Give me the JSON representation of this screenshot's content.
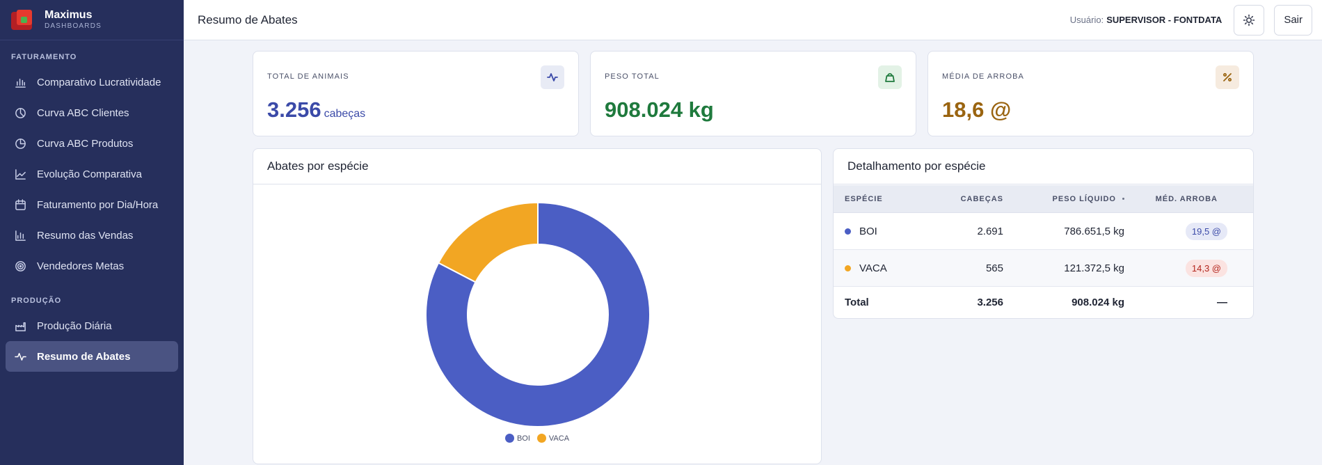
{
  "brand": {
    "name": "Maximus",
    "subtitle": "DASHBOARDS"
  },
  "sidebar": {
    "sections": [
      {
        "title": "FATURAMENTO",
        "items": [
          {
            "label": "Comparativo Lucratividade",
            "icon": "bar-chart-icon"
          },
          {
            "label": "Curva ABC Clientes",
            "icon": "pie-chart-icon"
          },
          {
            "label": "Curva ABC Produtos",
            "icon": "pie-chart-icon"
          },
          {
            "label": "Evolução Comparativa",
            "icon": "line-chart-icon"
          },
          {
            "label": "Faturamento por Dia/Hora",
            "icon": "calendar-icon"
          },
          {
            "label": "Resumo das Vendas",
            "icon": "bar-chart-icon"
          },
          {
            "label": "Vendedores Metas",
            "icon": "target-icon"
          }
        ]
      },
      {
        "title": "PRODUÇÃO",
        "items": [
          {
            "label": "Produção Diária",
            "icon": "factory-icon"
          },
          {
            "label": "Resumo de Abates",
            "icon": "activity-icon",
            "active": true
          }
        ]
      }
    ]
  },
  "header": {
    "title": "Resumo de Abates",
    "user_label": "Usuário:",
    "user_name": "SUPERVISOR - FONTDATA",
    "theme_icon": "sun-icon",
    "logout_label": "Sair"
  },
  "kpis": [
    {
      "label": "TOTAL DE ANIMAIS",
      "value": "3.256",
      "unit": "cabeças",
      "color": "#3b4aa8",
      "icon": "activity-icon",
      "icon_bg": "#e8ebf5",
      "icon_color": "#3b4aa8"
    },
    {
      "label": "PESO TOTAL",
      "value": "908.024 kg",
      "unit": "",
      "color": "#1f7a3d",
      "icon": "weight-icon",
      "icon_bg": "#e3f2e6",
      "icon_color": "#1f7a3d"
    },
    {
      "label": "MÉDIA DE ARROBA",
      "value": "18,6 @",
      "unit": "",
      "color": "#9a6410",
      "icon": "percent-icon",
      "icon_bg": "#f6ebdf",
      "icon_color": "#9a6410"
    }
  ],
  "chart_panel": {
    "title": "Abates por espécie"
  },
  "chart_data": {
    "type": "pie",
    "donut": true,
    "categories": [
      "BOI",
      "VACA"
    ],
    "values": [
      2691,
      565
    ],
    "colors": [
      "#4b5ec4",
      "#f2a623"
    ],
    "legend_position": "bottom"
  },
  "detail_panel": {
    "title": "Detalhamento por espécie",
    "columns": [
      "ESPÉCIE",
      "CABEÇAS",
      "PESO LÍQUIDO",
      "MÉD. ARROBA"
    ],
    "rows": [
      {
        "species": "BOI",
        "heads": "2.691",
        "weight": "786.651,5 kg",
        "avg": "19,5 @",
        "dot_color": "#4b5ec4",
        "badge_bg": "#e6e9f7",
        "badge_color": "#3b4aa8"
      },
      {
        "species": "VACA",
        "heads": "565",
        "weight": "121.372,5 kg",
        "avg": "14,3 @",
        "dot_color": "#f2a623",
        "badge_bg": "#fbe3e1",
        "badge_color": "#b3261e"
      }
    ],
    "total": {
      "label": "Total",
      "heads": "3.256",
      "weight": "908.024 kg",
      "avg": "—"
    }
  }
}
